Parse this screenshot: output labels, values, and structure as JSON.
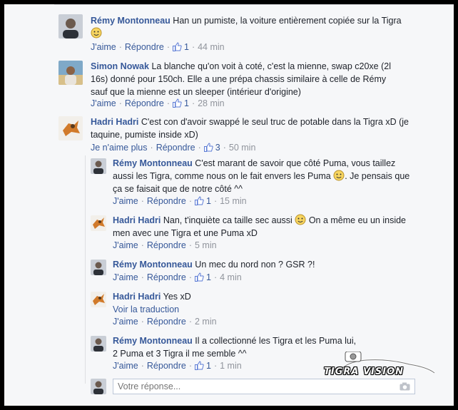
{
  "comments": [
    {
      "name": "Rémy Montonneau",
      "text": "Han un pumiste, la voiture entièrement copiée sur la Tigra",
      "like": "J'aime",
      "reply": "Répondre",
      "likes": "1",
      "time": "44 min"
    },
    {
      "name": "Simon Nowak",
      "text": "La blanche qu'on voit à coté, c'est la mienne, swap c20xe (2l 16s) donné pour 150ch. Elle a une prépa chassis similaire à celle de Rémy sauf que la mienne est un sleeper (intérieur d'origine)",
      "like": "J'aime",
      "reply": "Répondre",
      "likes": "1",
      "time": "28 min"
    },
    {
      "name": "Hadri Hadri",
      "text": "C'est con d'avoir swappé le seul truc de potable dans la Tigra xD (je taquine, pumiste inside xD)",
      "like": "Je n'aime plus",
      "reply": "Répondre",
      "likes": "3",
      "time": "50 min"
    }
  ],
  "replies": [
    {
      "name": "Rémy Montonneau",
      "text": "C'est marant de savoir que côté Puma, vous taillez aussi les Tigra, comme nous on le fait envers les Puma",
      "text2": ". Je pensais que ça se faisait que de notre côté ^^",
      "like": "J'aime",
      "reply": "Répondre",
      "likes": "1",
      "time": "15 min"
    },
    {
      "name": "Hadri Hadri",
      "text": "Nan, t'inquiète ca taille sec aussi",
      "text2": "On a même eu un inside men avec une Tigra et une Puma xD",
      "like": "J'aime",
      "reply": "Répondre",
      "time": "5 min"
    },
    {
      "name": "Rémy Montonneau",
      "text": "Un mec du nord non ? GSR ?!",
      "like": "J'aime",
      "reply": "Répondre",
      "likes": "1",
      "time": "4 min"
    },
    {
      "name": "Hadri Hadri",
      "text": "Yes xD",
      "translate": "Voir la traduction",
      "like": "J'aime",
      "reply": "Répondre",
      "time": "2 min"
    },
    {
      "name": "Rémy Montonneau",
      "text": "Il a collectionné les Tigra et les Puma lui, 2 Puma et 3 Tigra il me semble ^^",
      "like": "J'aime",
      "reply": "Répondre",
      "likes": "1",
      "time": "1 min"
    }
  ],
  "reply_box": {
    "placeholder": "Votre réponse..."
  },
  "watermark": {
    "text": "TIGRA VISION"
  },
  "colors": {
    "link": "#365899",
    "meta": "#90949c",
    "text": "#1d2129",
    "background": "#f6f7f9"
  }
}
